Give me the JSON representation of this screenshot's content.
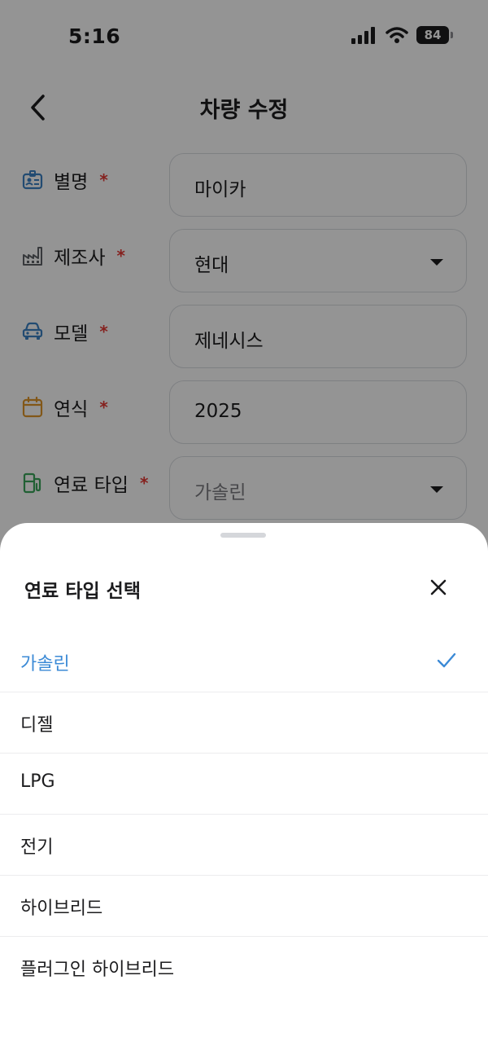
{
  "status": {
    "time": "5:16",
    "battery": "84"
  },
  "header": {
    "title": "차량 수정"
  },
  "form": {
    "required_mark": "*",
    "fields": [
      {
        "label": "별명",
        "value": "마이카",
        "icon": "id-badge-icon"
      },
      {
        "label": "제조사",
        "value": "현대",
        "icon": "factory-icon",
        "type": "select"
      },
      {
        "label": "모델",
        "value": "제네시스",
        "icon": "car-icon"
      },
      {
        "label": "연식",
        "value": "2025",
        "icon": "calendar-icon"
      },
      {
        "label": "연료 타입",
        "value": "가솔린",
        "icon": "fuel-pump-icon",
        "type": "select"
      }
    ]
  },
  "sheet": {
    "title": "연료 타입 선택",
    "options": [
      "가솔린",
      "디젤",
      "LPG",
      "전기",
      "하이브리드",
      "플러그인 하이브리드"
    ],
    "selected": "가솔린"
  },
  "colors": {
    "accent": "#3b8ad6",
    "required": "#e53935",
    "border": "#d9dce1",
    "icon_blue": "#3b82c4",
    "icon_gray": "#5f6368",
    "icon_orange": "#e0962a",
    "icon_green": "#3aa55a"
  }
}
